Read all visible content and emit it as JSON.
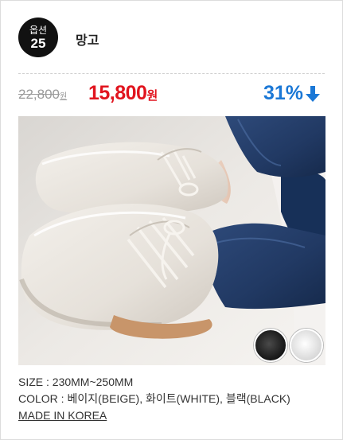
{
  "option": {
    "label": "옵션",
    "number": "25"
  },
  "product": {
    "name": "망고"
  },
  "price": {
    "original": "22,800",
    "original_unit": "원",
    "sale": "15,800",
    "sale_unit": "원",
    "discount": "31%",
    "discount_icon": "arrow-down-icon"
  },
  "image": {
    "subject": "loafer-shoes-photo",
    "swatches": [
      {
        "name": "black-swatch",
        "color": "#1a1a1a"
      },
      {
        "name": "white-swatch",
        "color": "#eeeeee"
      }
    ]
  },
  "specs": {
    "size": "SIZE : 230MM~250MM",
    "color": "COLOR : 베이지(BEIGE), 화이트(WHITE), 블랙(BLACK)",
    "origin": "MADE IN KOREA"
  },
  "colors": {
    "sale": "#e1141e",
    "discount": "#1b78d6",
    "badge": "#111111"
  }
}
